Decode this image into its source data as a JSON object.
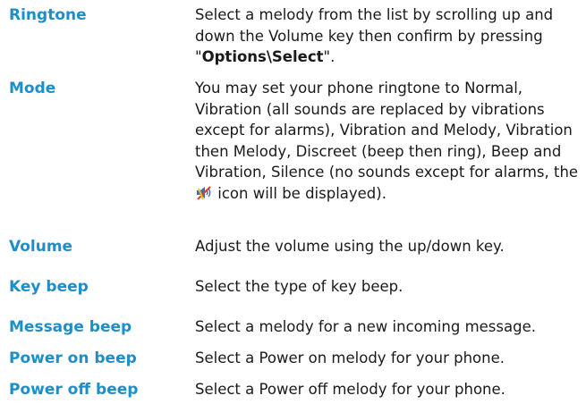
{
  "definitions": [
    {
      "term": "Ringtone",
      "desc_pre": "Select a melody from the list by scrolling up and down the Volume key then confirm by pressing \"",
      "desc_bold": "Options\\Select",
      "desc_post": "\"."
    },
    {
      "term": "Mode",
      "desc_pre": "You may set your phone ringtone to Normal, Vibration (all sounds are replaced by vibrations except for alarms), Vibration and Melody, Vibration then Melody, Discreet (beep then ring), Beep and Vibration, Silence (no sounds except for alarms, the",
      "icon": "silent-mode-icon",
      "desc_post": "icon will be displayed)."
    },
    {
      "term": "Volume",
      "desc": "Adjust the volume using the up/down key."
    },
    {
      "term": "Key beep",
      "desc": "Select the type of key beep."
    },
    {
      "term": "Message beep",
      "desc": "Select a melody for a new incoming message."
    },
    {
      "term": "Power on beep",
      "desc": "Select a Power on melody for your phone."
    },
    {
      "term": "Power off beep",
      "desc": "Select a Power off melody for your phone."
    }
  ],
  "colors": {
    "term": "#1e8ec9",
    "text": "#1a1a1a"
  }
}
